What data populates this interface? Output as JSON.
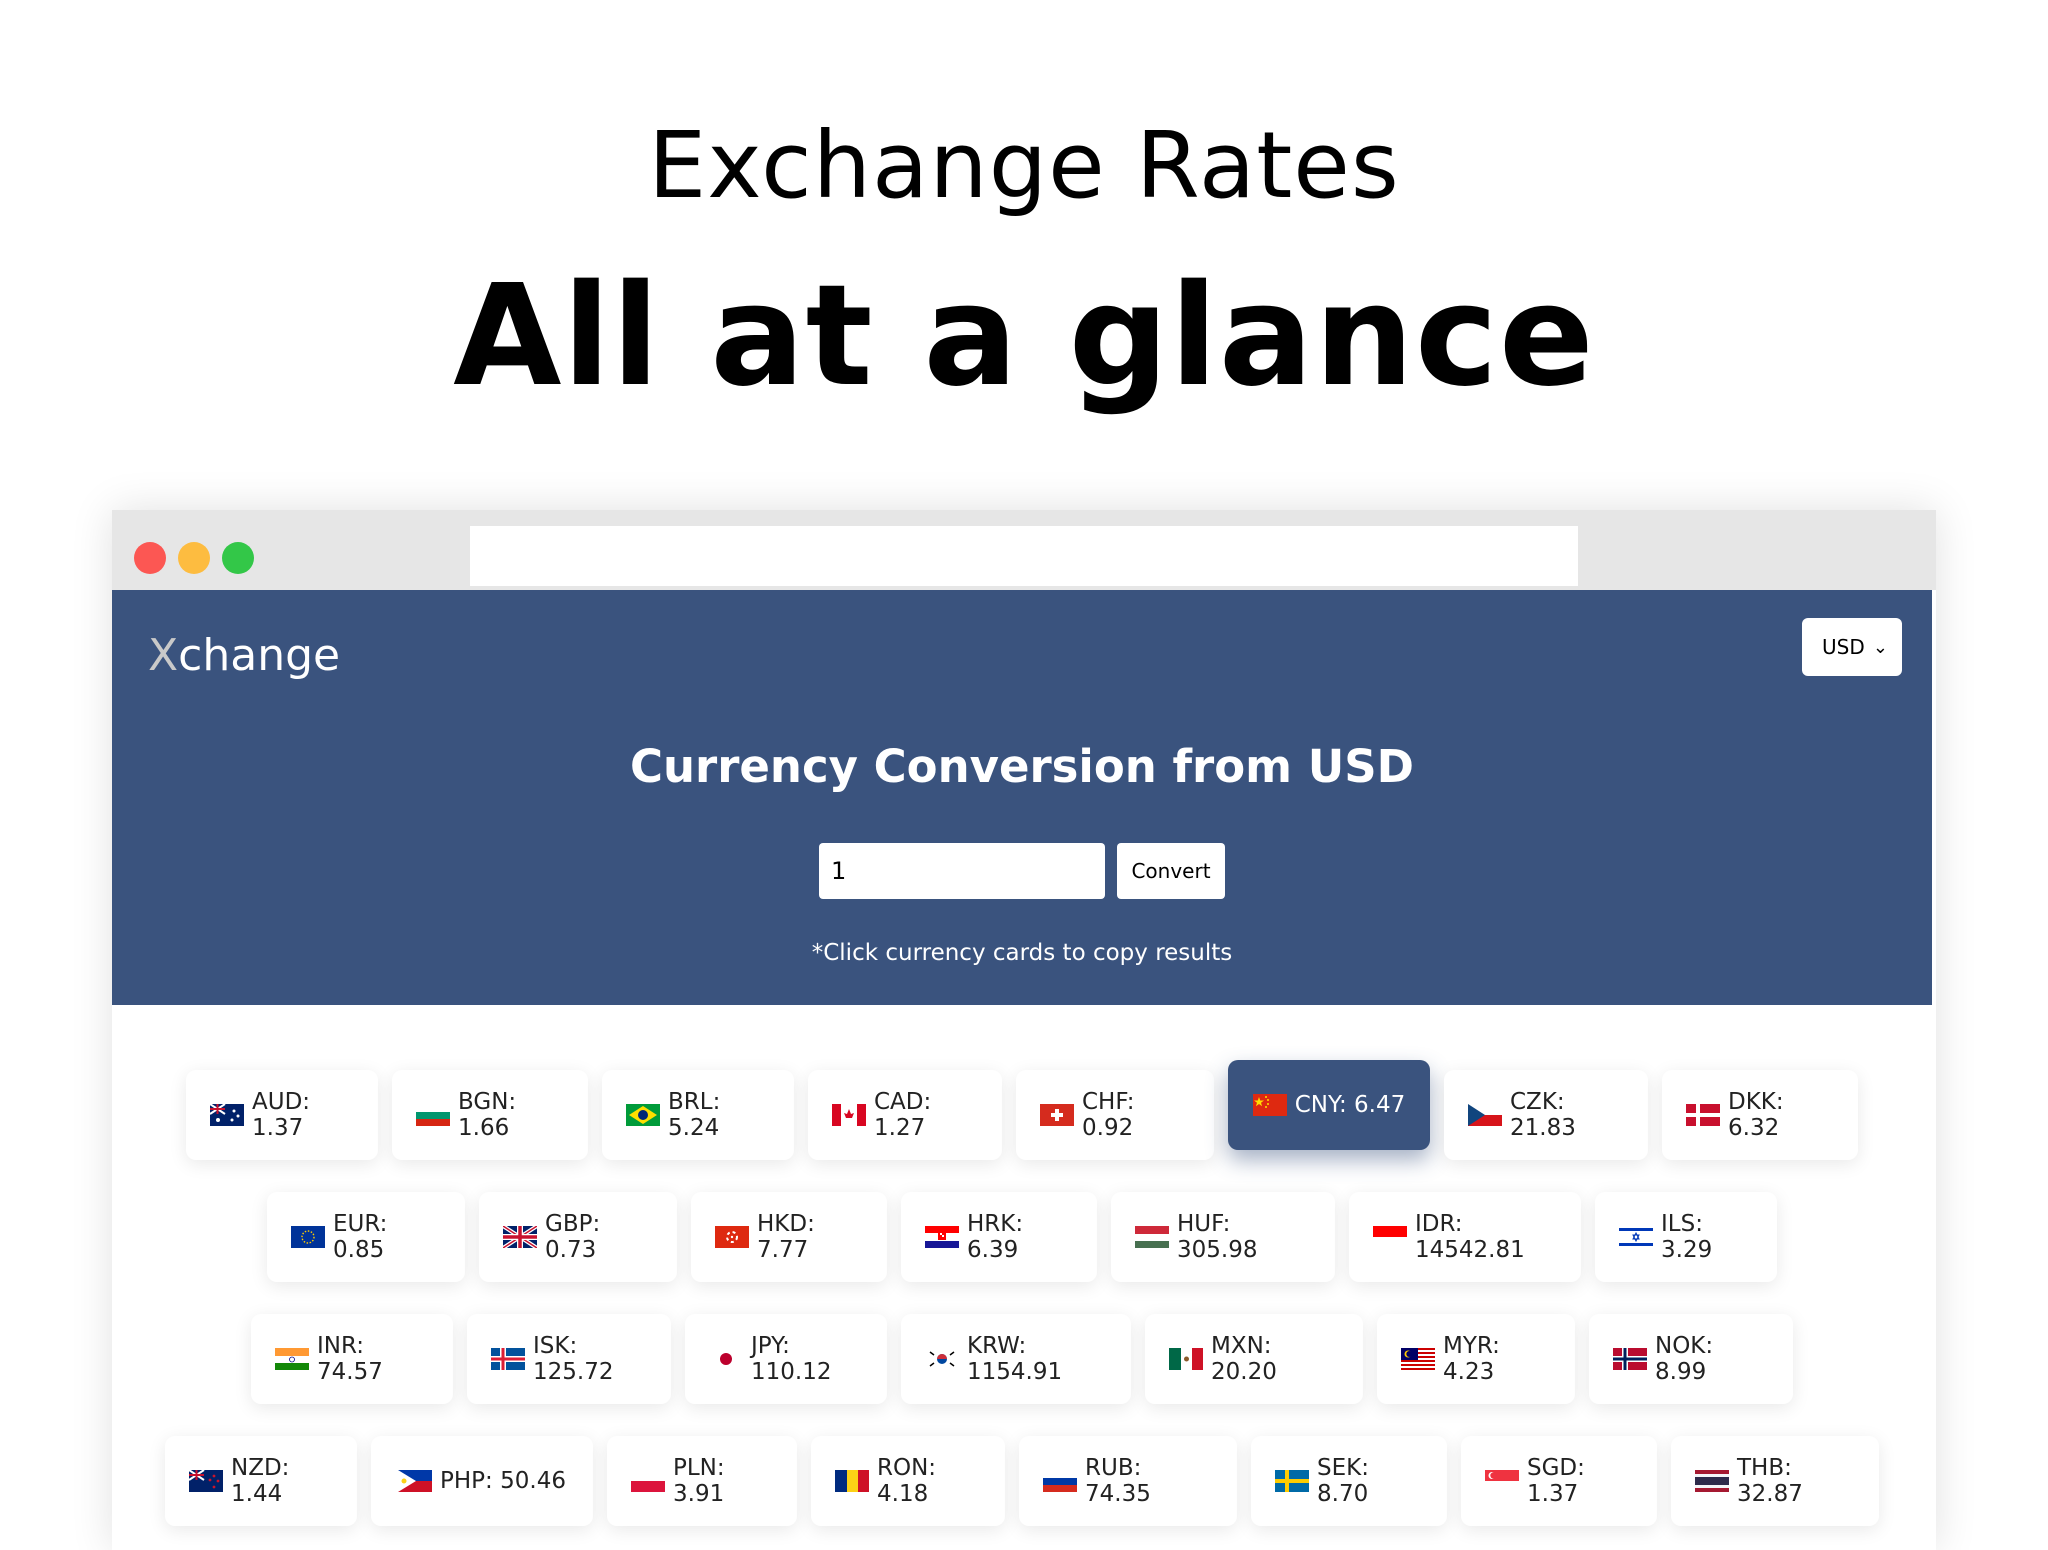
{
  "hero": {
    "line1": "Exchange Rates",
    "line2": "All at a glance"
  },
  "app": {
    "logo_x": "X",
    "logo_rest": "change",
    "base_currency": "USD",
    "title": "Currency Conversion from USD",
    "amount": "1",
    "convert_label": "Convert",
    "hint": "*Click currency cards to copy results"
  },
  "rates": {
    "row1": [
      {
        "text": "AUD: 1.37",
        "flag": "au-flag-icon"
      },
      {
        "text": "BGN: 1.66",
        "flag": "bg-flag-icon"
      },
      {
        "text": "BRL: 5.24",
        "flag": "br-flag-icon"
      },
      {
        "text": "CAD: 1.27",
        "flag": "ca-flag-icon"
      },
      {
        "text": "CHF: 0.92",
        "flag": "ch-flag-icon"
      },
      {
        "text": "CNY: 6.47",
        "flag": "cn-flag-icon",
        "selected": true
      },
      {
        "text": "CZK: 21.83",
        "flag": "cz-flag-icon"
      },
      {
        "text": "DKK: 6.32",
        "flag": "dk-flag-icon"
      }
    ],
    "row2": [
      {
        "text": "EUR: 0.85",
        "flag": "eu-flag-icon"
      },
      {
        "text": "GBP: 0.73",
        "flag": "gb-flag-icon"
      },
      {
        "text": "HKD: 7.77",
        "flag": "hk-flag-icon"
      },
      {
        "text": "HRK: 6.39",
        "flag": "hr-flag-icon"
      },
      {
        "text": "HUF: 305.98",
        "flag": "hu-flag-icon"
      },
      {
        "text": "IDR: 14542.81",
        "flag": "id-flag-icon"
      },
      {
        "text": "ILS: 3.29",
        "flag": "il-flag-icon"
      }
    ],
    "row3": [
      {
        "text": "INR: 74.57",
        "flag": "in-flag-icon"
      },
      {
        "text": "ISK: 125.72",
        "flag": "is-flag-icon"
      },
      {
        "text": "JPY: 110.12",
        "flag": "jp-flag-icon"
      },
      {
        "text": "KRW: 1154.91",
        "flag": "kr-flag-icon"
      },
      {
        "text": "MXN: 20.20",
        "flag": "mx-flag-icon"
      },
      {
        "text": "MYR: 4.23",
        "flag": "my-flag-icon"
      },
      {
        "text": "NOK: 8.99",
        "flag": "no-flag-icon"
      }
    ],
    "row4": [
      {
        "text": "NZD: 1.44",
        "flag": "nz-flag-icon"
      },
      {
        "text": "PHP: 50.46",
        "flag": "ph-flag-icon"
      },
      {
        "text": "PLN: 3.91",
        "flag": "pl-flag-icon"
      },
      {
        "text": "RON: 4.18",
        "flag": "ro-flag-icon"
      },
      {
        "text": "RUB: 74.35",
        "flag": "ru-flag-icon"
      },
      {
        "text": "SEK: 8.70",
        "flag": "se-flag-icon"
      },
      {
        "text": "SGD: 1.37",
        "flag": "sg-flag-icon"
      },
      {
        "text": "THB: 32.87",
        "flag": "th-flag-icon"
      }
    ]
  },
  "colors": {
    "header_bg": "#3a537e",
    "active_card": "#3a537e"
  }
}
